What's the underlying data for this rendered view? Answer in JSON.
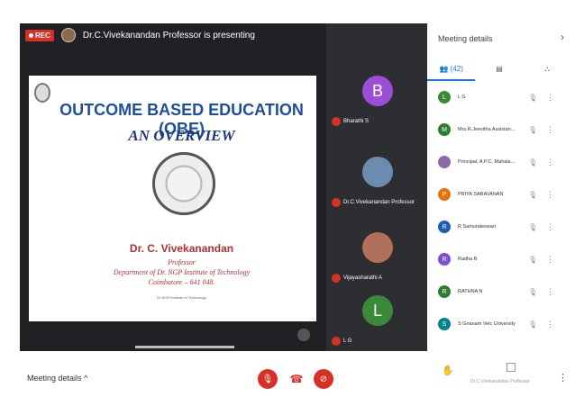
{
  "topbar": {
    "rec": "REC",
    "presenter_text": "Dr.C.Vivekanandan Professor is presenting"
  },
  "slide": {
    "title": "OUTCOME BASED EDUCATION (OBE)",
    "subtitle": "AN OVERVIEW",
    "name": "Dr. C. Vivekanandan",
    "role": "Professor",
    "dept": "Department of Dr. NGP Institute of Technology",
    "city": "Coimbatore – 641 048.",
    "footer": "Dr NGP Institute of Technology"
  },
  "tiles": [
    {
      "initial": "B",
      "name": "Bharathi S",
      "color": "#9c4fd6"
    },
    {
      "initial": "",
      "name": "Dr.C.Vivekanandan Professor",
      "color": "#6b8cae"
    },
    {
      "initial": "",
      "name": "Vijayasharathi A",
      "color": "#b0705a"
    },
    {
      "initial": "L",
      "name": "L G",
      "color": "#3a8a3a"
    }
  ],
  "panel": {
    "title": "Meeting details",
    "tabs": [
      "(42)",
      "",
      ""
    ],
    "participants": [
      {
        "initial": "L",
        "name": "L G",
        "color": "#3a8a3a"
      },
      {
        "initial": "M",
        "name": "Mrs.R.Jeevitha Assistan...",
        "color": "#2e7d32"
      },
      {
        "initial": "",
        "name": "Principal, A.P.C. Mahala...",
        "color": "#8e6ba8"
      },
      {
        "initial": "P",
        "name": "PRIYA SARAVANAN",
        "color": "#e8710a"
      },
      {
        "initial": "R",
        "name": "R Samundeswari",
        "color": "#1a5fb4"
      },
      {
        "initial": "R",
        "name": "Radha B",
        "color": "#7b4fd6"
      },
      {
        "initial": "R",
        "name": "RATHNA N",
        "color": "#2e7d32"
      },
      {
        "initial": "S",
        "name": "S Gnanam Velc University",
        "color": "#00838f"
      }
    ]
  },
  "bottom": {
    "meeting_details": "Meeting details",
    "footer_name": "Dr.C.Vivekanandan Professor"
  },
  "colors": {
    "stage": "#202124",
    "accent": "#1a73e8",
    "danger": "#d93025"
  }
}
